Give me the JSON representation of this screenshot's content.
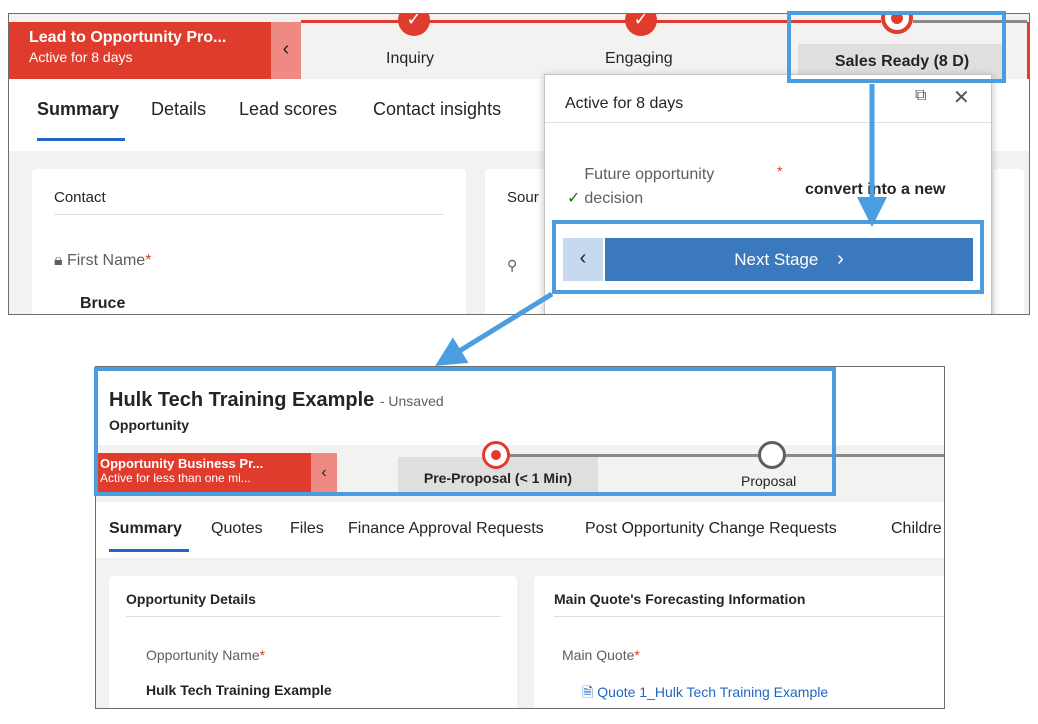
{
  "top": {
    "process_flag": {
      "title": "Lead to Opportunity Pro...",
      "subtitle": "Active for 8 days"
    },
    "stages": [
      {
        "label": "Inquiry"
      },
      {
        "label": "Engaging"
      },
      {
        "label": "Sales Ready  (8 D)"
      }
    ],
    "tabs": [
      "Summary",
      "Details",
      "Lead scores",
      "Contact insights"
    ],
    "contact_card": {
      "title": "Contact",
      "field_label": "First Name",
      "field_value": "Bruce"
    },
    "source_card": {
      "title_partial": "Sour"
    },
    "flyout": {
      "header": "Active for 8 days",
      "step_label": "Future opportunity decision",
      "note": "convert into a new",
      "next_stage_label": "Next Stage"
    }
  },
  "bottom": {
    "opportunity_title": "Hulk Tech Training Example",
    "unsaved_label": "- Unsaved",
    "entity_label": "Opportunity",
    "process_flag": {
      "title": "Opportunity Business Pr...",
      "subtitle": "Active for less than one mi..."
    },
    "stages": [
      {
        "label": "Pre-Proposal  (< 1 Min)"
      },
      {
        "label": "Proposal"
      }
    ],
    "tabs": [
      "Summary",
      "Quotes",
      "Files",
      "Finance Approval Requests",
      "Post Opportunity Change Requests",
      "Childre"
    ],
    "opportunity_details": {
      "title": "Opportunity Details",
      "field_label": "Opportunity Name",
      "field_value": "Hulk Tech Training Example"
    },
    "forecasting": {
      "title": "Main Quote's Forecasting Information",
      "field_label": "Main Quote",
      "field_value": "Quote 1_Hulk Tech Training Example"
    }
  },
  "colors": {
    "accent_red": "#e03c2e",
    "callout_blue": "#4a9de0",
    "next_button": "#3b79be",
    "link_blue": "#2266c1"
  },
  "icons": [
    "check-icon",
    "chevron-left-icon",
    "chevron-right-icon",
    "lock-icon",
    "key-icon",
    "pop-out-icon",
    "close-icon",
    "quote-icon"
  ]
}
